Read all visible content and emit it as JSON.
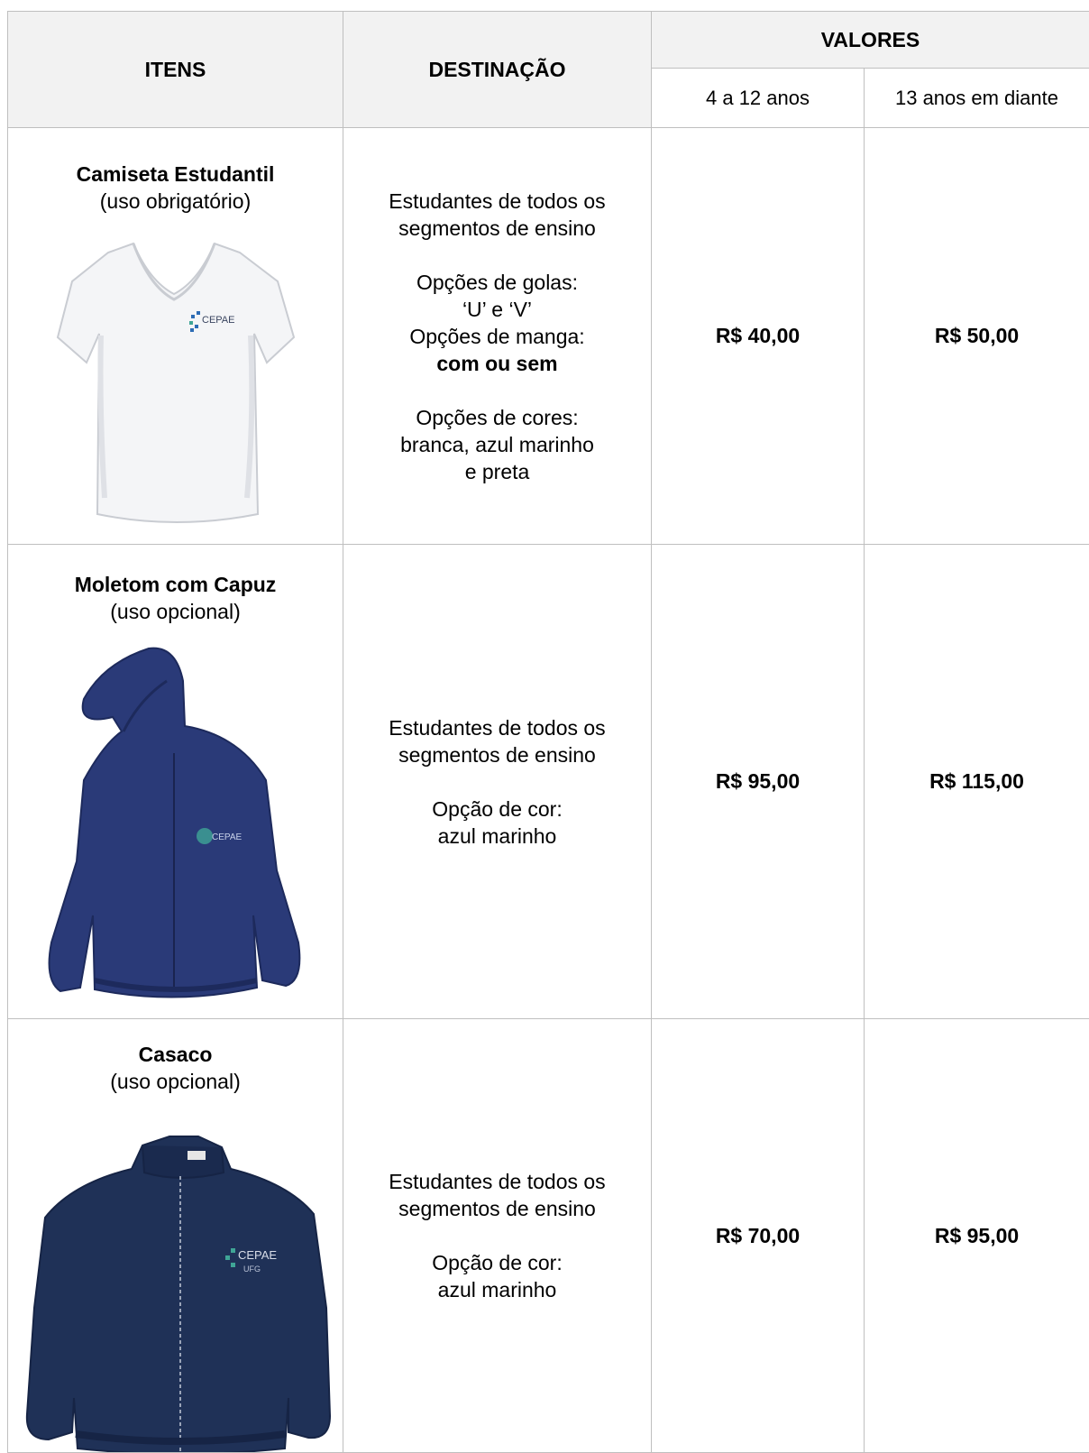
{
  "header": {
    "itens": "ITENS",
    "destinacao": "DESTINAÇÃO",
    "valores": "VALORES",
    "age_1": "4 a 12 anos",
    "age_2": "13 anos em diante"
  },
  "rows": [
    {
      "title": "Camiseta Estudantil",
      "subtitle": "(uso obrigatório)",
      "image_icon": "white-tshirt-icon",
      "dest": {
        "line1": "Estudantes de todos os",
        "line2": "segmentos de ensino",
        "line3": "Opções de golas:",
        "line4": "‘U’ e ‘V’",
        "line5": "Opções de manga:",
        "line6": "com ou sem",
        "line7": "Opções de cores:",
        "line8": "branca, azul marinho",
        "line9": "e preta"
      },
      "price_1": "R$ 40,00",
      "price_2": "R$ 50,00"
    },
    {
      "title": "Moletom com Capuz",
      "subtitle": "(uso opcional)",
      "image_icon": "navy-hoodie-icon",
      "dest": {
        "line1": "Estudantes de todos os",
        "line2": "segmentos de ensino",
        "line3": "Opção de cor:",
        "line4": "azul marinho"
      },
      "price_1": "R$ 95,00",
      "price_2": "R$ 115,00"
    },
    {
      "title": "Casaco",
      "subtitle": "(uso opcional)",
      "image_icon": "navy-jacket-icon",
      "dest": {
        "line1": "Estudantes de todos os",
        "line2": "segmentos de ensino",
        "line3": "Opção de cor:",
        "line4": "azul marinho"
      },
      "price_1": "R$ 70,00",
      "price_2": "R$ 95,00"
    }
  ],
  "logo_text": "CEPAE",
  "logo_sub": "UFG",
  "colors": {
    "header_bg": "#f2f2f2",
    "border": "#bfbfbf",
    "navy": "#2a3a78",
    "jacket_navy": "#1f3157",
    "shirt_white": "#f4f5f7",
    "logo_blue": "#2d6cb5",
    "logo_teal": "#3fa596"
  }
}
